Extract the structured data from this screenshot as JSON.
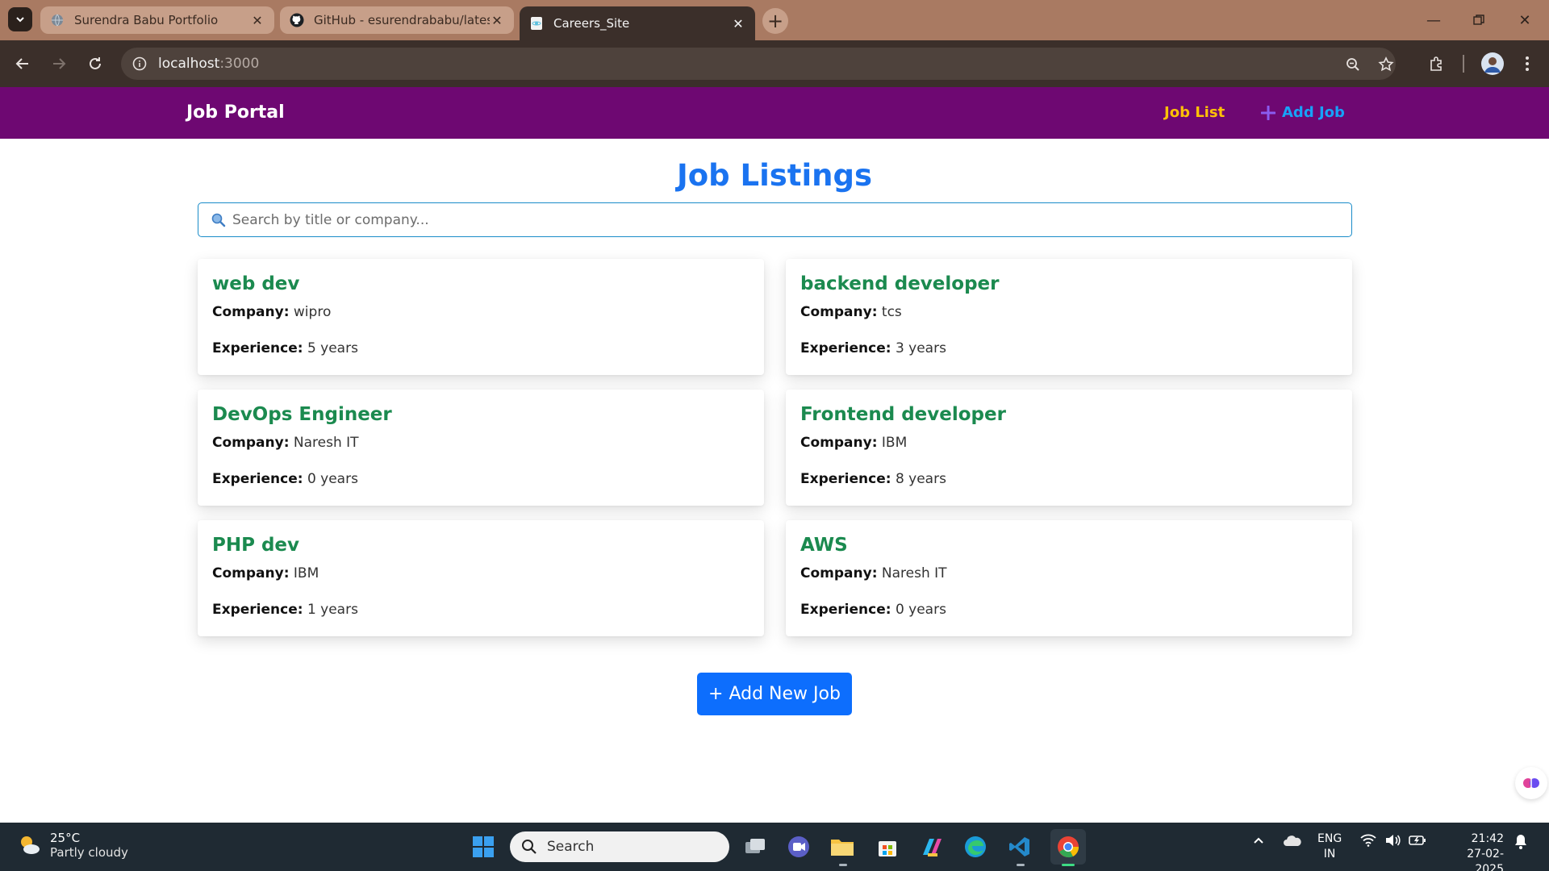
{
  "browser": {
    "tabs": [
      {
        "title": "Surendra Babu Portfolio",
        "active": false
      },
      {
        "title": "GitHub - esurendrababu/latest",
        "active": false
      },
      {
        "title": "Careers_Site",
        "active": true
      }
    ],
    "url_host": "localhost",
    "url_port": ":3000"
  },
  "app": {
    "brand": "Job Portal",
    "nav": {
      "job_list": "Job List",
      "add_job": "Add Job"
    },
    "page_title": "Job Listings",
    "search_placeholder": "Search by title or company...",
    "labels": {
      "company": "Company:",
      "experience": "Experience:"
    },
    "jobs": [
      {
        "title": "web dev",
        "company": "wipro",
        "experience": "5 years"
      },
      {
        "title": "backend developer",
        "company": "tcs",
        "experience": "3 years"
      },
      {
        "title": "DevOps Engineer",
        "company": "Naresh IT",
        "experience": "0 years"
      },
      {
        "title": "Frontend developer",
        "company": "IBM",
        "experience": "8 years"
      },
      {
        "title": "PHP dev",
        "company": "IBM",
        "experience": "1 years"
      },
      {
        "title": "AWS",
        "company": "Naresh IT",
        "experience": "0 years"
      }
    ],
    "add_button": "+ Add New Job",
    "colors": {
      "navbar": "#6e0872",
      "title": "#1a73f0",
      "job_title": "#1b8a4f",
      "button": "#0d6efd",
      "nav_job_list": "#ffc107",
      "nav_add_job": "#17a2f8"
    }
  },
  "taskbar": {
    "weather_temp": "25°C",
    "weather_text": "Partly cloudy",
    "search_label": "Search",
    "lang_top": "ENG",
    "lang_bottom": "IN",
    "time": "21:42",
    "date": "27-02-2025"
  }
}
